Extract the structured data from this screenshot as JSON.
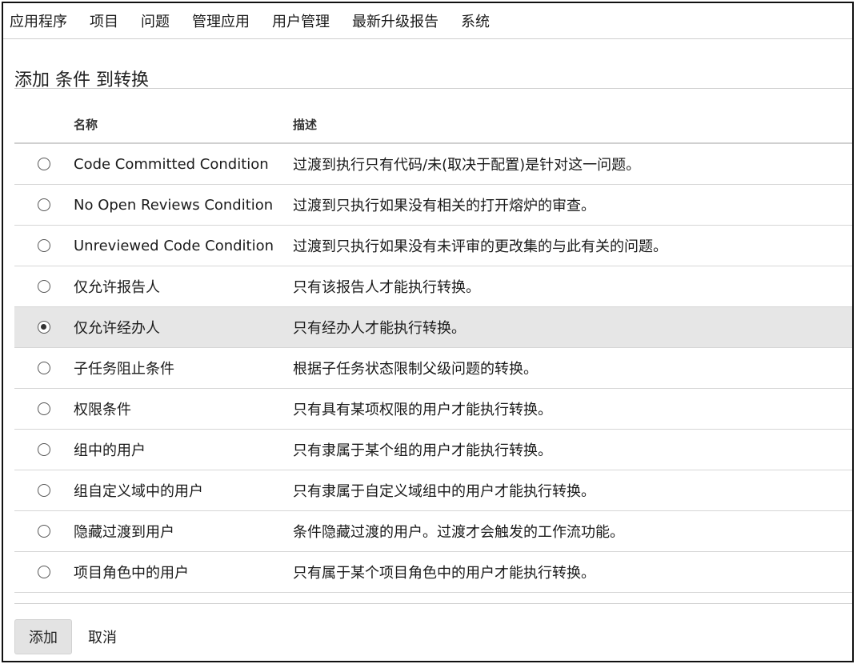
{
  "nav": {
    "items": [
      "应用程序",
      "项目",
      "问题",
      "管理应用",
      "用户管理",
      "最新升级报告",
      "系统"
    ]
  },
  "page": {
    "title": "添加 条件 到转换"
  },
  "table": {
    "headers": {
      "name": "名称",
      "description": "描述"
    },
    "rows": [
      {
        "name": "Code Committed Condition",
        "description": "过渡到执行只有代码/未(取决于配置)是针对这一问题。",
        "selected": false
      },
      {
        "name": "No Open Reviews Condition",
        "description": "过渡到只执行如果没有相关的打开熔炉的审查。",
        "selected": false
      },
      {
        "name": "Unreviewed Code Condition",
        "description": "过渡到只执行如果没有未评审的更改集的与此有关的问题。",
        "selected": false
      },
      {
        "name": "仅允许报告人",
        "description": "只有该报告人才能执行转换。",
        "selected": false
      },
      {
        "name": "仅允许经办人",
        "description": "只有经办人才能执行转换。",
        "selected": true
      },
      {
        "name": "子任务阻止条件",
        "description": "根据子任务状态限制父级问题的转换。",
        "selected": false
      },
      {
        "name": "权限条件",
        "description": "只有具有某项权限的用户才能执行转换。",
        "selected": false
      },
      {
        "name": "组中的用户",
        "description": "只有隶属于某个组的用户才能执行转换。",
        "selected": false
      },
      {
        "name": "组自定义域中的用户",
        "description": "只有隶属于自定义域组中的用户才能执行转换。",
        "selected": false
      },
      {
        "name": "隐藏过渡到用户",
        "description": "条件隐藏过渡的用户。过渡才会触发的工作流功能。",
        "selected": false
      },
      {
        "name": "项目角色中的用户",
        "description": "只有属于某个项目角色中的用户才能执行转换。",
        "selected": false
      }
    ]
  },
  "actions": {
    "add_label": "添加",
    "cancel_label": "取消"
  },
  "colors": {
    "selected_row_bg": "#e6e6e6",
    "rule": "#cfcfcf",
    "button_bg": "#e3e3e3"
  }
}
